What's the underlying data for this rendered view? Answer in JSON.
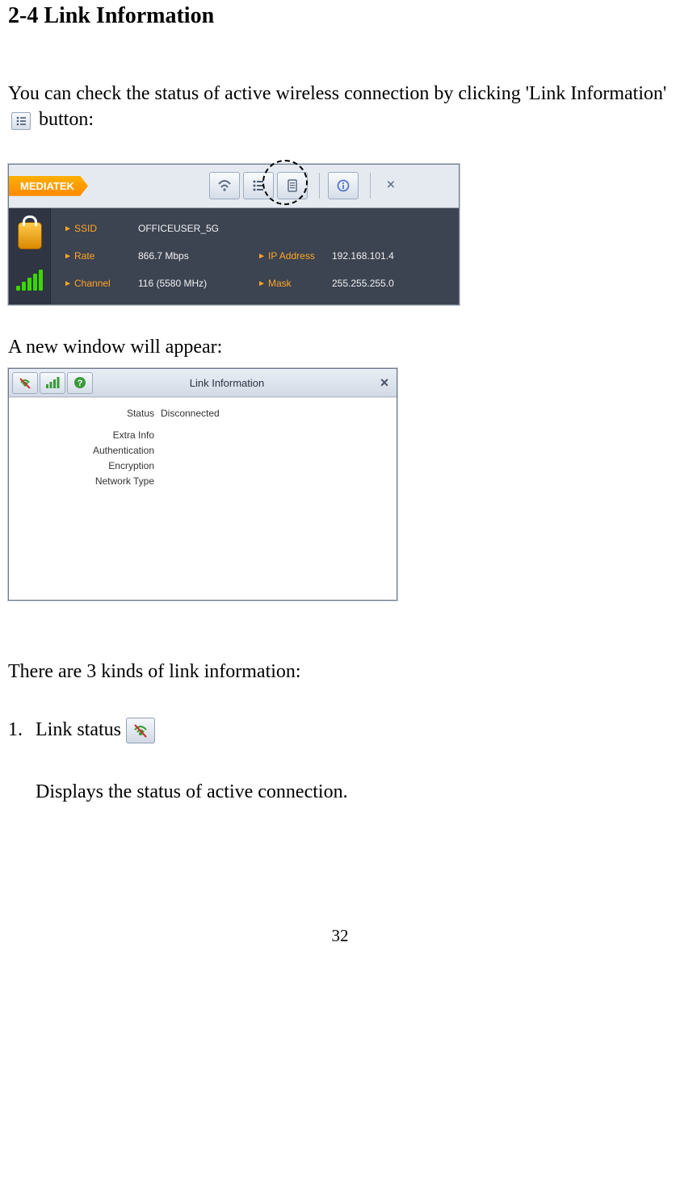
{
  "heading": "2-4 Link Information",
  "intro_text_1": "You can check the status of active wireless connection by clicking 'Link Information' ",
  "intro_text_2": " button:",
  "screenshot1": {
    "brand": "MEDIATEK",
    "labels": {
      "ssid": "SSID",
      "rate": "Rate",
      "channel": "Channel",
      "ip": "IP Address",
      "mask": "Mask"
    },
    "values": {
      "ssid": "OFFICEUSER_5G",
      "rate": "866.7 Mbps",
      "channel": "116 (5580 MHz)",
      "ip": "192.168.101.4",
      "mask": "255.255.255.0"
    }
  },
  "mid_text": "A new window will appear:",
  "screenshot2": {
    "title": "Link Information",
    "fields": {
      "status_label": "Status",
      "status_value": "Disconnected",
      "extra_label": "Extra Info",
      "auth_label": "Authentication",
      "enc_label": "Encryption",
      "net_label": "Network Type"
    }
  },
  "after_text": "There are 3 kinds of link information:",
  "item1_prefix": "1.",
  "item1_text": "Link status",
  "item1_desc": "Displays the status of active connection.",
  "page_number": "32"
}
